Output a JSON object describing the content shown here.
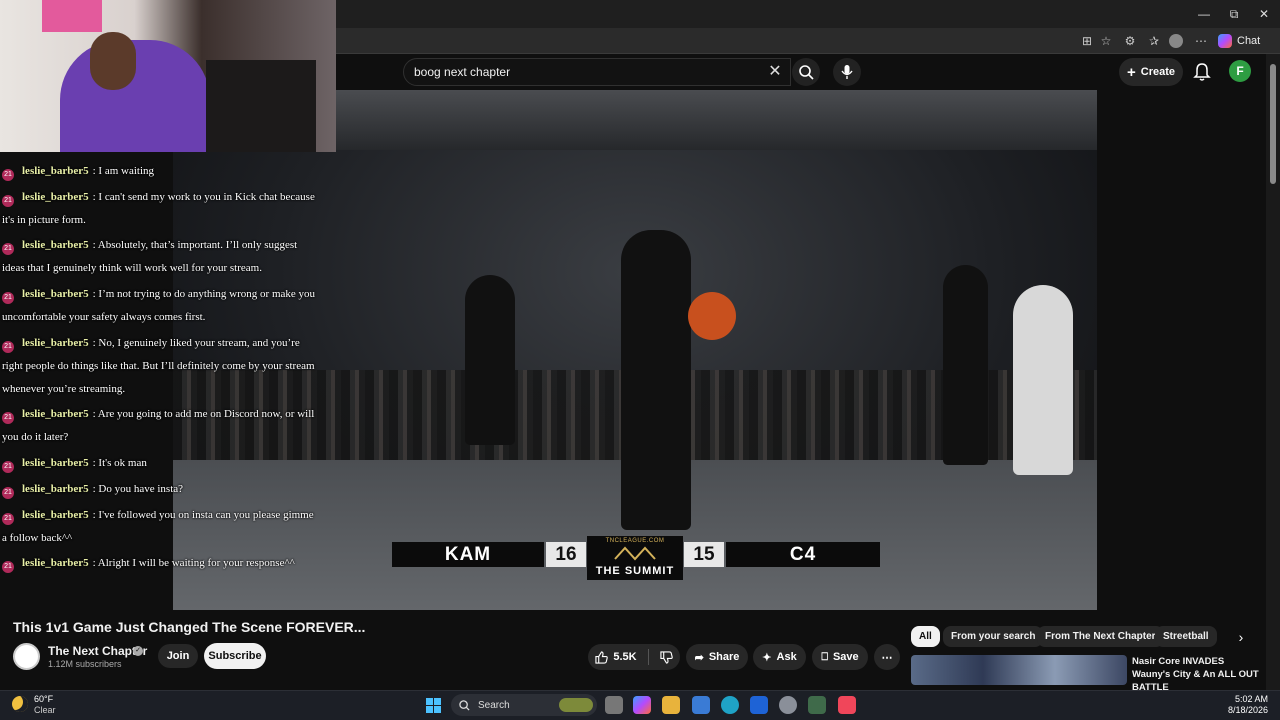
{
  "browser": {
    "window_controls": {
      "minimize": "—",
      "restore": "⧉",
      "close": "✕"
    },
    "toolbar_icons": [
      "tab-actions-icon",
      "favorite-star-icon",
      "extension-icon",
      "favorites-icon",
      "profile-icon",
      "more-icon"
    ],
    "chat_label": "Chat"
  },
  "youtube": {
    "search": {
      "query": "boog next chapter"
    },
    "create_label": "Create",
    "avatar_letter": "F"
  },
  "video": {
    "scoreboard": {
      "player_left": "KAM",
      "score_left": "16",
      "score_right": "15",
      "player_right": "C4",
      "site": "TNCLEAGUE.COM",
      "event": "THE SUMMIT"
    }
  },
  "chat": {
    "messages": [
      {
        "user": "leslie_barber5",
        "text": ": I am waiting"
      },
      {
        "user": "leslie_barber5",
        "text": ": I can't send my work to you in Kick chat because it's in picture form."
      },
      {
        "user": "leslie_barber5",
        "text": ": Absolutely, that’s important. I’ll only suggest ideas that I genuinely think will work well for your stream."
      },
      {
        "user": "leslie_barber5",
        "text": ": I’m not trying to do anything wrong or make you uncomfortable your safety always comes first."
      },
      {
        "user": "leslie_barber5",
        "text": ": No, I genuinely liked your stream, and you’re right people do things like that. But I’ll definitely come by your stream whenever you’re streaming."
      },
      {
        "user": "leslie_barber5",
        "text": ": Are you going to add me on Discord now, or will you do it later?"
      },
      {
        "user": "leslie_barber5",
        "text": ": It's ok man"
      },
      {
        "user": "leslie_barber5",
        "text": ": Do you have insta?"
      },
      {
        "user": "leslie_barber5",
        "text": ": I've followed you on insta can you please gimme a follow back^^"
      },
      {
        "user": "leslie_barber5",
        "text": ": Alright I will be waiting for your response^^"
      }
    ]
  },
  "watch": {
    "title": "This 1v1 Game Just Changed The Scene FOREVER...",
    "channel": "The Next Chapter",
    "subscribers": "1.12M subscribers",
    "join_label": "Join",
    "subscribe_label": "Subscribe",
    "likes": "5.5K",
    "share_label": "Share",
    "ask_label": "Ask",
    "save_label": "Save"
  },
  "sidebar": {
    "chips": [
      "All",
      "From your search",
      "From The Next Chapter",
      "Streetball"
    ],
    "recommendation": {
      "title": "Nasir Core INVADES Wauny's City & An ALL OUT BATTLE"
    }
  },
  "taskbar": {
    "temperature": "60°F",
    "condition": "Clear",
    "search_label": "Search",
    "time": "5:02 AM",
    "date": "8/18/2026"
  },
  "colors": {
    "accent": "#3ea6ff",
    "subscribe_bg": "#f1f1f1",
    "chat_user": "#e9f0a8",
    "avatar": "#2e9d42"
  }
}
